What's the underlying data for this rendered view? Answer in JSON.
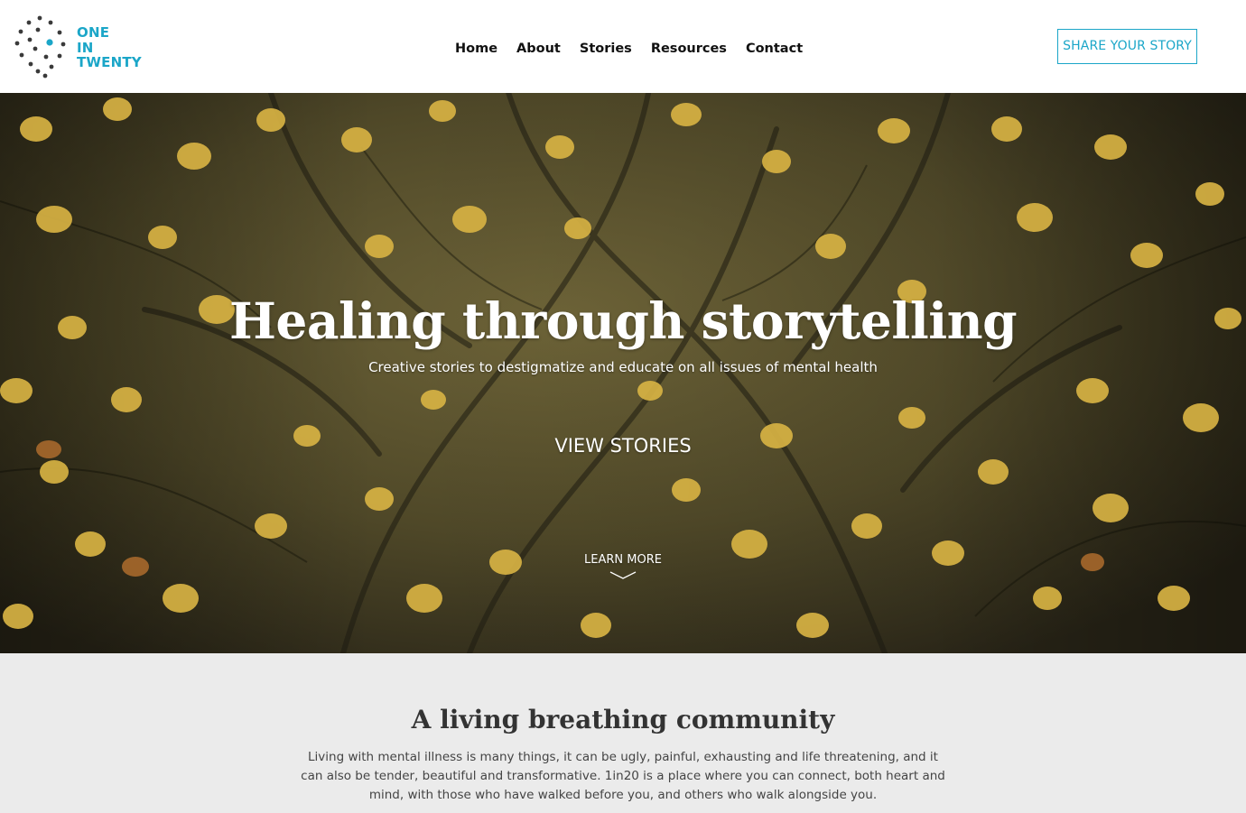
{
  "header": {
    "logo": {
      "lines": [
        "ONE",
        "IN",
        "TWENTY"
      ],
      "icon": "dotted-circle-logo-icon",
      "accent_color": "#1ba6c8"
    },
    "nav": [
      {
        "label": "Home"
      },
      {
        "label": "About"
      },
      {
        "label": "Stories"
      },
      {
        "label": "Resources"
      },
      {
        "label": "Contact"
      }
    ],
    "share_button": "SHARE YOUR STORY"
  },
  "hero": {
    "background": "autumn-leaves-on-water-photo",
    "title": "Healing through storytelling",
    "subtitle": "Creative stories to destigmatize and educate on all issues of mental health",
    "cta": "VIEW STORIES",
    "learn_more": "LEARN MORE",
    "learn_more_icon": "chevron-down-icon"
  },
  "community": {
    "title": "A living breathing community",
    "body": "Living with mental illness is many things, it can be ugly, painful, exhausting and life threatening, and it can also be tender, beautiful and transformative. 1in20 is a place where you can connect, both heart and mind, with those who have walked before you, and others who walk alongside you."
  },
  "colors": {
    "accent": "#1ba6c8",
    "section_bg": "#ebebeb",
    "hero_overlay": "#4a4426"
  }
}
